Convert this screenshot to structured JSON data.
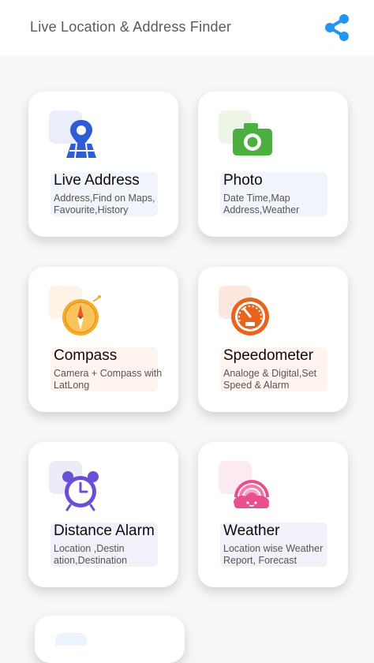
{
  "app": {
    "title": "Live Location & Address Finder",
    "accent": "#2196f3"
  },
  "cards": [
    {
      "title": "Live Address",
      "desc": "Address,Find on Maps, Favourite,History",
      "icon": "map-pin-icon",
      "tint": "#f0f2fb"
    },
    {
      "title": "Photo",
      "desc": "Date Time,Map Address,Weather",
      "icon": "camera-icon",
      "tint": "#f0f2fb"
    },
    {
      "title": "Compass",
      "desc": "Camera + Compass with LatLong",
      "icon": "compass-icon",
      "tint": "#fff4ef"
    },
    {
      "title": "Speedometer",
      "desc": "Analoge & Digital,Set Speed & Alarm",
      "icon": "speedometer-icon",
      "tint": "#fff4ef"
    },
    {
      "title": "Distance Alarm",
      "desc": "Location ,Destin ation,Destination",
      "icon": "alarm-clock-icon",
      "tint": "#f1f1fa"
    },
    {
      "title": "Weather",
      "desc": "Location wise Weather Report, Forecast",
      "icon": "weather-rainbow-icon",
      "tint": "#f1f1fa"
    }
  ]
}
